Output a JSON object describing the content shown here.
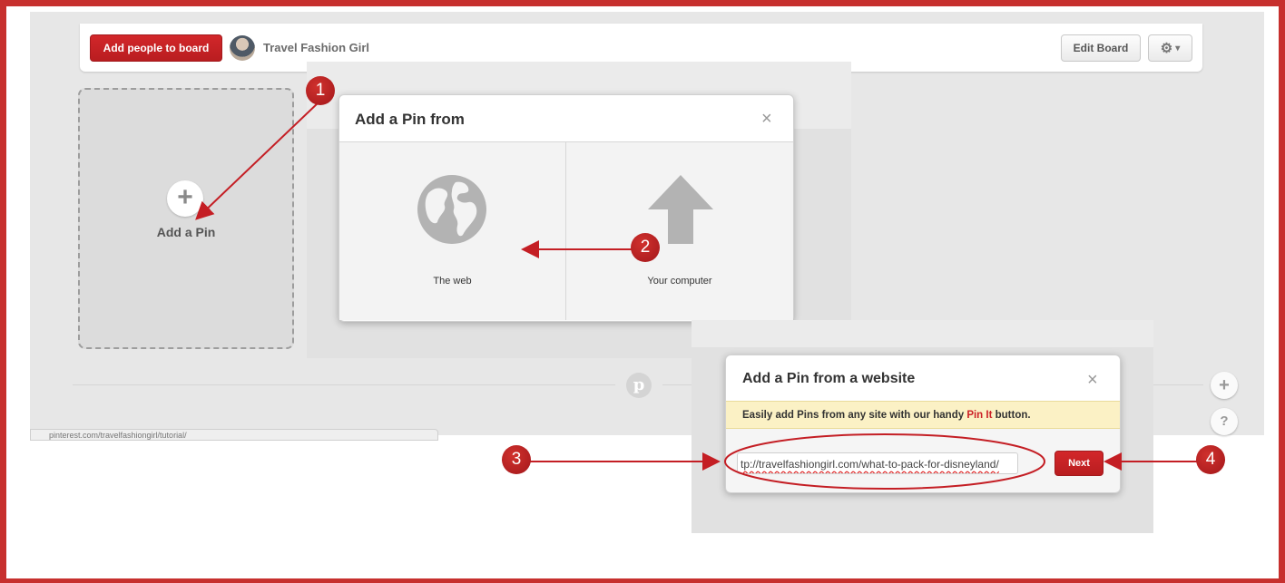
{
  "board_header": {
    "add_people_label": "Add people to board",
    "board_name": "Travel Fashion Girl",
    "edit_board_label": "Edit Board",
    "gear_caret": "▾"
  },
  "add_pin_card": {
    "plus_symbol": "+",
    "label": "Add a Pin"
  },
  "modal_source": {
    "title": "Add a Pin from",
    "close": "×",
    "option_web": "The web",
    "option_computer": "Your computer"
  },
  "modal_website": {
    "title": "Add a Pin from a website",
    "close": "×",
    "notice_before": "Easily add Pins from any site with our handy ",
    "notice_link": "Pin It",
    "notice_after": " button.",
    "url_value": "tp://travelfashiongirl.com/what-to-pack-for-disneyland/",
    "next_label": "Next"
  },
  "footer": {
    "pin_logo": "p",
    "plus_symbol": "+",
    "help_symbol": "?",
    "status_url": "pinterest.com/travelfashiongirl/tutorial/"
  },
  "callouts": [
    "1",
    "2",
    "3",
    "4"
  ],
  "colors": {
    "accent": "#c7302e",
    "button_red": "#cc2127"
  },
  "icons": [
    "avatar",
    "gear-icon",
    "plus-icon",
    "globe-icon",
    "upload-arrow-icon",
    "close-icon",
    "pinterest-logo-icon",
    "help-icon"
  ]
}
